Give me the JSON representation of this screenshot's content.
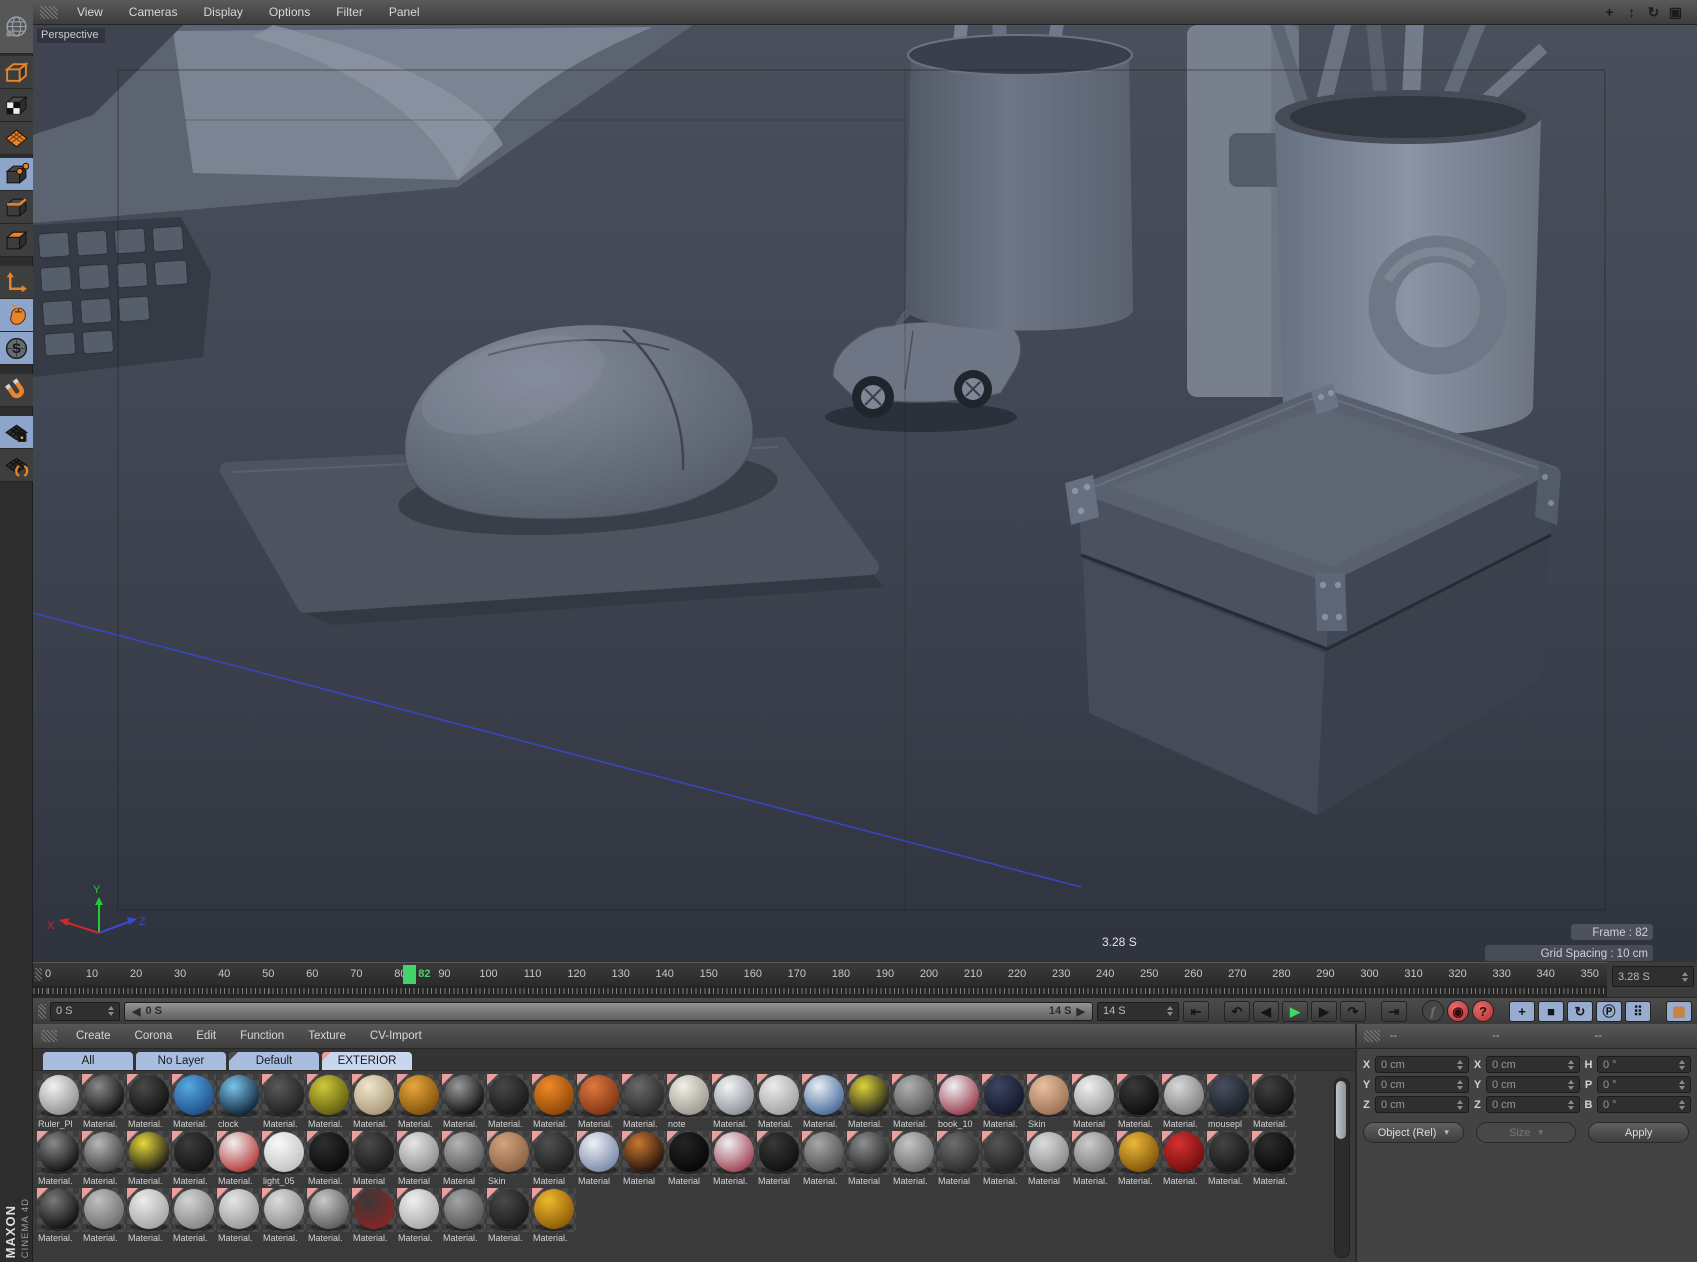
{
  "menubar": {
    "menus": [
      "View",
      "Cameras",
      "Display",
      "Options",
      "Filter",
      "Panel"
    ],
    "right_icons": [
      {
        "name": "move-view-icon",
        "glyph": "+"
      },
      {
        "name": "zoom-view-icon",
        "glyph": "↕"
      },
      {
        "name": "rotate-view-icon",
        "glyph": "↻"
      },
      {
        "name": "toggle-view-icon",
        "glyph": "▣"
      }
    ]
  },
  "left_toolbar": {
    "items": [
      {
        "name": "c4d-globe",
        "icon": "globe",
        "active": false,
        "gap": 0
      },
      {
        "name": "make-editable",
        "icon": "cube-outline",
        "active": false,
        "gap": 2
      },
      {
        "name": "model-mode",
        "icon": "cube-checker",
        "active": false,
        "gap": 0
      },
      {
        "name": "texture-mode",
        "icon": "grid-plane",
        "active": false,
        "gap": 0
      },
      {
        "name": "points-mode",
        "icon": "cube-points",
        "active": true,
        "gap": 3
      },
      {
        "name": "edges-mode",
        "icon": "cube-edges",
        "active": false,
        "gap": 0
      },
      {
        "name": "polygons-mode",
        "icon": "cube-polys",
        "active": false,
        "gap": 0
      },
      {
        "name": "enable-axis",
        "icon": "axis",
        "active": false,
        "gap": 9
      },
      {
        "name": "mouse-tool",
        "icon": "mouse",
        "active": true,
        "gap": 0
      },
      {
        "name": "snap-s",
        "icon": "s-sphere",
        "active": true,
        "gap": 0
      },
      {
        "name": "magnet-tool",
        "icon": "magnet",
        "active": false,
        "gap": 9
      },
      {
        "name": "workplane-lock",
        "icon": "grid-lock",
        "active": true,
        "gap": 9
      },
      {
        "name": "workplane-mode",
        "icon": "grid-parens",
        "active": false,
        "gap": 0
      }
    ]
  },
  "viewport": {
    "label": "Perspective",
    "hud": {
      "time": "3.28 S",
      "frame": "Frame : 82",
      "grid_spacing": "Grid Spacing : 10 cm"
    },
    "axis": {
      "x": "X",
      "y": "Y",
      "z": "Z"
    }
  },
  "timeline": {
    "ticks": [
      0,
      10,
      20,
      30,
      40,
      50,
      60,
      70,
      80,
      90,
      100,
      110,
      120,
      130,
      140,
      150,
      160,
      170,
      180,
      190,
      200,
      210,
      220,
      230,
      240,
      250,
      260,
      270,
      280,
      290,
      300,
      310,
      320,
      330,
      340,
      350
    ],
    "playhead": "82",
    "time_field": "3.28 S",
    "start_field": "0 S",
    "range_start": "0 S",
    "range_end": "14 S",
    "range_left_icon": "◀",
    "range_right_icon": "▶",
    "end_field": "14 S",
    "transport": [
      {
        "name": "goto-start-button",
        "glyph": "⇤",
        "cls": ""
      },
      {
        "name": "prev-key-button",
        "glyph": "↶",
        "cls": "gapL"
      },
      {
        "name": "prev-frame-button",
        "glyph": "◀",
        "cls": ""
      },
      {
        "name": "play-button",
        "glyph": "▶",
        "cls": "play"
      },
      {
        "name": "next-frame-button",
        "glyph": "▶",
        "cls": ""
      },
      {
        "name": "next-key-button",
        "glyph": "↷",
        "cls": ""
      },
      {
        "name": "goto-end-button",
        "glyph": "⇥",
        "cls": "gapL"
      },
      {
        "name": "record-objects-button",
        "glyph": "ƒ",
        "cls": "round dim gapL"
      },
      {
        "name": "autokey-button",
        "glyph": "◉",
        "cls": "round red"
      },
      {
        "name": "help-button",
        "glyph": "?",
        "cls": "round red"
      },
      {
        "name": "key-position-toggle",
        "glyph": "+",
        "cls": "blue gapL"
      },
      {
        "name": "key-scale-toggle",
        "glyph": "■",
        "cls": "blue"
      },
      {
        "name": "key-rotation-toggle",
        "glyph": "↻",
        "cls": "blue"
      },
      {
        "name": "key-parameter-toggle",
        "glyph": "Ⓟ",
        "cls": "blue"
      },
      {
        "name": "key-pla-toggle",
        "glyph": "⠿",
        "cls": "blue"
      },
      {
        "name": "sound-toggle",
        "glyph": "▦",
        "cls": "blue film gapL"
      }
    ]
  },
  "materials": {
    "menus": [
      "Create",
      "Corona",
      "Edit",
      "Function",
      "Texture",
      "CV-Import"
    ],
    "tabs": [
      {
        "label": "All",
        "corner": "",
        "active": false
      },
      {
        "label": "No Layer",
        "corner": "",
        "active": false
      },
      {
        "label": "Default",
        "corner": "dark",
        "active": false
      },
      {
        "label": "EXTERIOR",
        "corner": "pink",
        "active": true
      }
    ],
    "rows": [
      [
        {
          "t": "Ruler_Pl",
          "a": "#f2f2f2",
          "b": "#8e8e8e",
          "p": 0
        },
        {
          "t": "Material.",
          "a": "#8a8a8a",
          "b": "#0d0d0d",
          "p": 1
        },
        {
          "t": "Material.",
          "a": "#4a4a4a",
          "b": "#101010",
          "p": 1
        },
        {
          "t": "Material.",
          "a": "#58a8e0",
          "b": "#1c4d86",
          "p": 1
        },
        {
          "t": "clock",
          "a": "#7ac4ee",
          "b": "#0d2236",
          "p": 0
        },
        {
          "t": "Material.",
          "a": "#5a5a5a",
          "b": "#1e1e1e",
          "p": 1
        },
        {
          "t": "Material.",
          "a": "#cfc93a",
          "b": "#5e5a10",
          "p": 1
        },
        {
          "t": "Material.",
          "a": "#f0e6cc",
          "b": "#a99877",
          "p": 1
        },
        {
          "t": "Material.",
          "a": "#e8a83c",
          "b": "#7e4e0c",
          "p": 1
        },
        {
          "t": "Material.",
          "a": "#9a9a9a",
          "b": "#0a0a0a",
          "p": 1
        },
        {
          "t": "Material.",
          "a": "#484848",
          "b": "#161616",
          "p": 1
        },
        {
          "t": "Material.",
          "a": "#f08a28",
          "b": "#8a4408",
          "p": 1
        },
        {
          "t": "Material.",
          "a": "#e07840",
          "b": "#7c3412",
          "p": 1
        },
        {
          "t": "Material.",
          "a": "#6a6a6a",
          "b": "#262626",
          "p": 1
        },
        {
          "t": "note",
          "a": "#f2f0e6",
          "b": "#9a988e",
          "p": 1
        },
        {
          "t": "Material.",
          "a": "#f4f4f4",
          "b": "#8a8f9a",
          "p": 1
        },
        {
          "t": "Material.",
          "a": "#ececec",
          "b": "#a0a0a0",
          "p": 1
        },
        {
          "t": "Material.",
          "a": "#e8eef6",
          "b": "#46689a",
          "p": 1
        },
        {
          "t": "Material.",
          "a": "#ded43a",
          "b": "#1c1c1c",
          "p": 1
        },
        {
          "t": "Material.",
          "a": "#b0b0b0",
          "b": "#565656",
          "p": 1
        },
        {
          "t": "book_10",
          "a": "#f0f0f4",
          "b": "#97394a",
          "p": 1
        },
        {
          "t": "Material.",
          "a": "#3c4662",
          "b": "#12162a",
          "p": 1
        },
        {
          "t": "Skin",
          "a": "#e8c0a0",
          "b": "#9a6f52",
          "p": 1
        },
        {
          "t": "Material",
          "a": "#f0f0f0",
          "b": "#9a9a9a",
          "p": 1
        },
        {
          "t": "Material.",
          "a": "#3a3a3a",
          "b": "#0c0c0c",
          "p": 1
        },
        {
          "t": "Material.",
          "a": "#d8d8d8",
          "b": "#7e7e7e",
          "p": 1
        },
        {
          "t": "mousepl",
          "a": "#49505e",
          "b": "#181c26",
          "p": 1
        },
        {
          "t": "Material.",
          "a": "#404040",
          "b": "#101010",
          "p": 1
        }
      ],
      [
        {
          "t": "Material.",
          "a": "#8a8a8a",
          "b": "#0d0d0d",
          "p": 1
        },
        {
          "t": "Material.",
          "a": "#b8b8b8",
          "b": "#3c3c3c",
          "p": 1
        },
        {
          "t": "Material.",
          "a": "#e8d83a",
          "b": "#141414",
          "p": 1
        },
        {
          "t": "Material.",
          "a": "#3c3c3c",
          "b": "#121212",
          "p": 1
        },
        {
          "t": "Material.",
          "a": "#f0f0f0",
          "b": "#b43838",
          "p": 1
        },
        {
          "t": "light_05",
          "a": "#fafafa",
          "b": "#c2c2c2",
          "p": 1
        },
        {
          "t": "Material.",
          "a": "#2e2e2e",
          "b": "#0a0a0a",
          "p": 1
        },
        {
          "t": "Material",
          "a": "#4a4a4a",
          "b": "#181818",
          "p": 1
        },
        {
          "t": "Material",
          "a": "#e6e6e6",
          "b": "#8e8e8e",
          "p": 1
        },
        {
          "t": "Material",
          "a": "#b4b4b4",
          "b": "#5a5a5a",
          "p": 1
        },
        {
          "t": "Skin",
          "a": "#d4a47e",
          "b": "#8a5f42",
          "p": 1
        },
        {
          "t": "Material",
          "a": "#505050",
          "b": "#1c1c1c",
          "p": 1
        },
        {
          "t": "Material",
          "a": "#eef0f6",
          "b": "#7888a8",
          "p": 1
        },
        {
          "t": "Material",
          "a": "#c87830",
          "b": "#20100a",
          "p": 1
        },
        {
          "t": "Material",
          "a": "#242424",
          "b": "#060606",
          "p": 1
        },
        {
          "t": "Material.",
          "a": "#eef0f4",
          "b": "#a04050",
          "p": 1
        },
        {
          "t": "Material",
          "a": "#383838",
          "b": "#0e0e0e",
          "p": 1
        },
        {
          "t": "Material.",
          "a": "#a8a8a8",
          "b": "#4e4e4e",
          "p": 1
        },
        {
          "t": "Material",
          "a": "#909090",
          "b": "#222222",
          "p": 1
        },
        {
          "t": "Material.",
          "a": "#c4c4c4",
          "b": "#6a6a6a",
          "p": 1
        },
        {
          "t": "Material",
          "a": "#6e6e6e",
          "b": "#2a2a2a",
          "p": 1
        },
        {
          "t": "Material.",
          "a": "#565656",
          "b": "#202020",
          "p": 1
        },
        {
          "t": "Material",
          "a": "#dcdcdc",
          "b": "#8a8a8a",
          "p": 1
        },
        {
          "t": "Material.",
          "a": "#cccccc",
          "b": "#787878",
          "p": 1
        },
        {
          "t": "Material.",
          "a": "#ecb83a",
          "b": "#7e5208",
          "p": 1
        },
        {
          "t": "Material.",
          "a": "#d83030",
          "b": "#6e0e0e",
          "p": 1
        },
        {
          "t": "Material.",
          "a": "#444444",
          "b": "#141414",
          "p": 1
        },
        {
          "t": "Material.",
          "a": "#2c2c2c",
          "b": "#080808",
          "p": 1
        }
      ],
      [
        {
          "t": "Material.",
          "a": "#7a7a7a",
          "b": "#0d0d0d",
          "p": 1
        },
        {
          "t": "Material.",
          "a": "#c0c0c0",
          "b": "#6e6e6e",
          "p": 1
        },
        {
          "t": "Material.",
          "a": "#ececec",
          "b": "#a4a4a4",
          "p": 1
        },
        {
          "t": "Material.",
          "a": "#d4d4d4",
          "b": "#848484",
          "p": 1
        },
        {
          "t": "Material.",
          "a": "#e6e6e6",
          "b": "#989898",
          "p": 1
        },
        {
          "t": "Material.",
          "a": "#dcdcdc",
          "b": "#8e8e8e",
          "p": 1
        },
        {
          "t": "Material.",
          "a": "#c8c8c8",
          "b": "#5a5a5a",
          "p": 1
        },
        {
          "t": "Material.",
          "a": "#383838",
          "b": "#8a2424",
          "p": 1
        },
        {
          "t": "Material.",
          "a": "#f0f0f0",
          "b": "#a8a8a8",
          "p": 1
        },
        {
          "t": "Material.",
          "a": "#a4a4a4",
          "b": "#565656",
          "p": 1
        },
        {
          "t": "Material.",
          "a": "#4a4a4a",
          "b": "#181818",
          "p": 1
        },
        {
          "t": "Material.",
          "a": "#f0b82e",
          "b": "#8a5a06",
          "p": 1
        }
      ]
    ]
  },
  "coordinates": {
    "headers": [
      "--",
      "--",
      "--"
    ],
    "rows": [
      {
        "l1": "X",
        "v1": "0 cm",
        "l2": "X",
        "v2": "0 cm",
        "l3": "H",
        "v3": "0 °"
      },
      {
        "l1": "Y",
        "v1": "0 cm",
        "l2": "Y",
        "v2": "0 cm",
        "l3": "P",
        "v3": "0 °"
      },
      {
        "l1": "Z",
        "v1": "0 cm",
        "l2": "Z",
        "v2": "0 cm",
        "l3": "B",
        "v3": "0 °"
      }
    ],
    "mode_button": "Object (Rel)",
    "size_button": "Size",
    "apply_button": "Apply"
  },
  "branding": {
    "maxon": "MAXON",
    "cinema": "CINEMA 4D"
  }
}
